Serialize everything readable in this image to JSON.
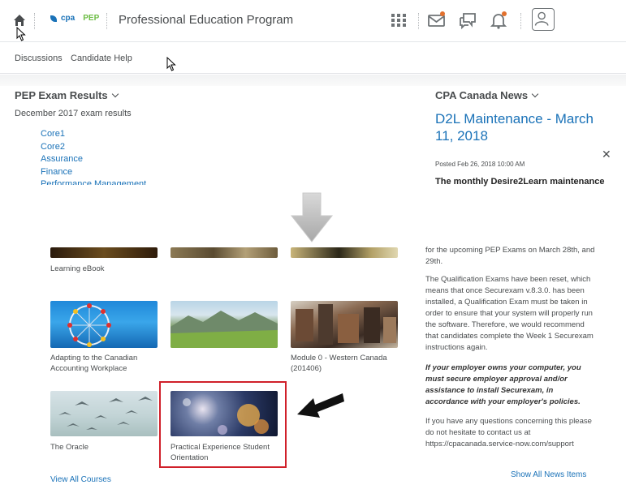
{
  "header": {
    "brand_cpa": "cpa",
    "brand_pep": "PEP",
    "program_title": "Professional Education Program",
    "icons": [
      "home-icon",
      "course-grid-icon",
      "message-icon",
      "discussion-icon",
      "notification-bell-icon",
      "profile-icon"
    ],
    "alert_color": "#e2702d"
  },
  "subnav": {
    "items": [
      "Discussions",
      "Candidate Help"
    ]
  },
  "exam_widget": {
    "title": "PEP Exam Results",
    "subtitle": "December 2017 exam results",
    "links": [
      "Core1",
      "Core2",
      "Assurance",
      "Finance",
      "Performance Management"
    ]
  },
  "news_widget": {
    "title": "CPA Canada News",
    "headline": "D2L Maintenance - March 11, 2018",
    "posted": "Posted Feb 26, 2018 10:00 AM",
    "lead": "The monthly Desire2Learn maintenance",
    "close": "✕"
  },
  "courses": {
    "tiles": [
      {
        "caption": "Learning eBook"
      },
      {
        "caption": ""
      },
      {
        "caption": ""
      },
      {
        "caption": "Adapting to the Canadian Accounting Workplace"
      },
      {
        "caption": ""
      },
      {
        "caption": "Module 0 - Western Canada (201406)"
      },
      {
        "caption": "The Oracle"
      },
      {
        "caption": "Practical Experience Student Orientation"
      }
    ],
    "view_all": "View All Courses",
    "highlight_color": "#d0202a"
  },
  "news_body": {
    "p1": "for the upcoming PEP Exams on March 28th, and 29th.",
    "p2": "The Qualification Exams have been reset, which means that once Securexam v.8.3.0. has been installed, a Qualification Exam must be taken in order to ensure that your system will properly run the software. Therefore, we would recommend that candidates complete the Week 1 Securexam instructions again.",
    "p3": "If your employer owns your computer, you must secure employer approval and/or assistance to install Securexam, in accordance with your employer's policies.",
    "p4": "If you have any questions concerning this please do not hesitate to contact us at https://cpacanada.service-now.com/support",
    "show_all": "Show All News Items"
  },
  "theme": {
    "link_color": "#1a72b8",
    "text_color": "#494c4e"
  }
}
